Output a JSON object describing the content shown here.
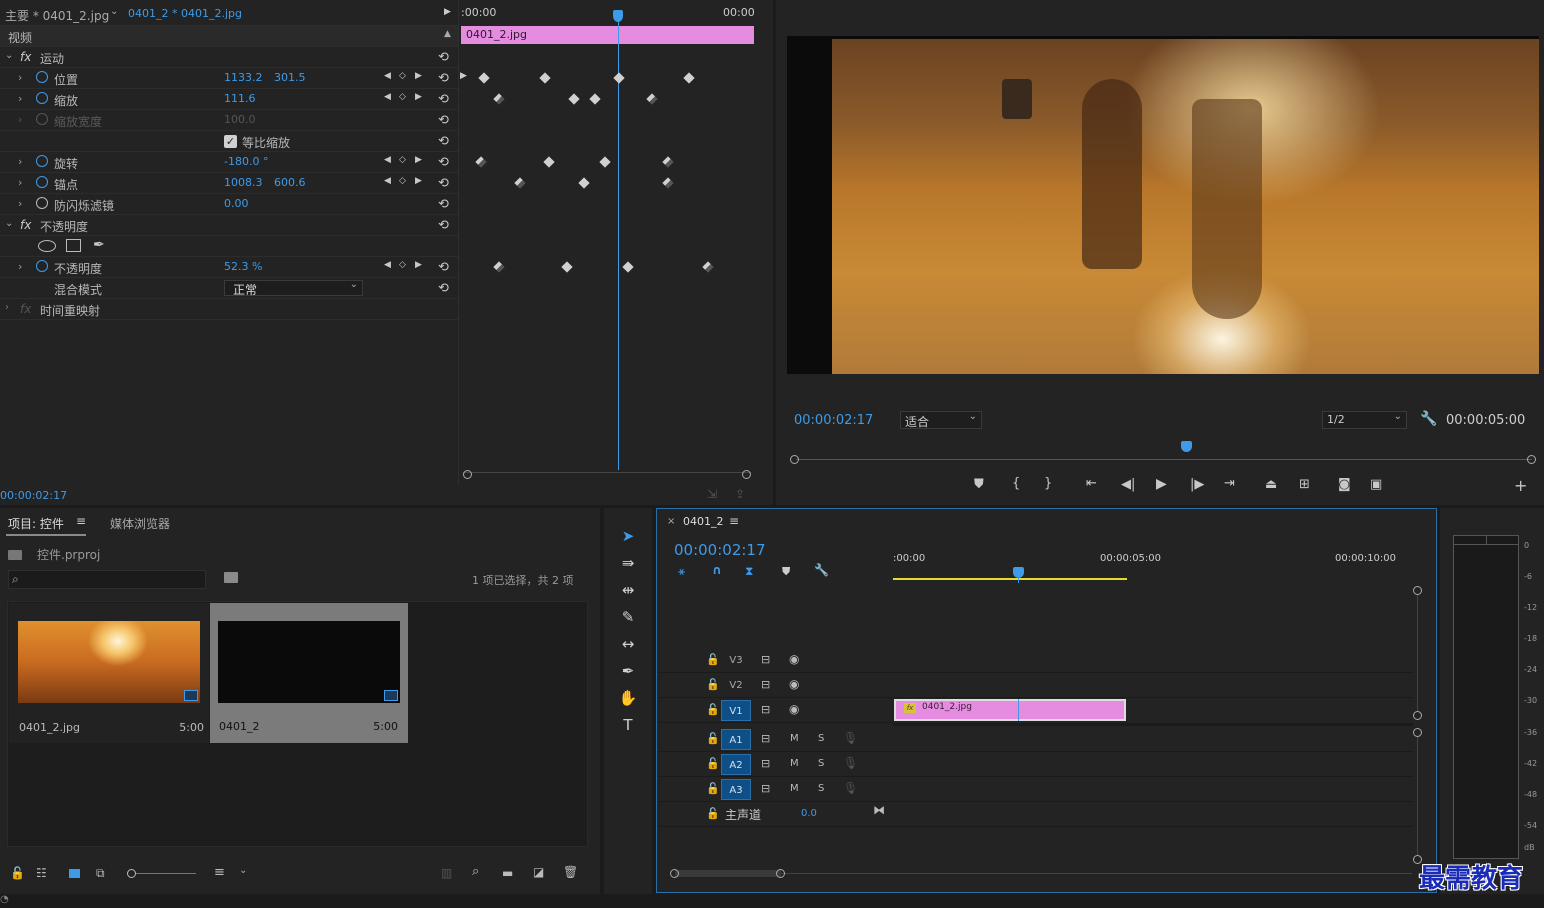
{
  "effect_controls": {
    "tab_main": "主要 * 0401_2.jpg",
    "tab_sequence": "0401_2 * 0401_2.jpg",
    "section_video": "视频",
    "time_start": ":00:00",
    "time_end": "00:00",
    "clip_label": "0401_2.jpg",
    "current_time": "00:00:02:17",
    "motion": {
      "label": "运动",
      "position": {
        "label": "位置",
        "x": "1133.2",
        "y": "301.5"
      },
      "scale": {
        "label": "缩放",
        "value": "111.6"
      },
      "scale_width": {
        "label": "缩放宽度",
        "value": "100.0"
      },
      "uniform_scale": "等比缩放",
      "rotation": {
        "label": "旋转",
        "value": "-180.0 °"
      },
      "anchor": {
        "label": "锚点",
        "x": "1008.3",
        "y": "600.6"
      },
      "anti_flicker": {
        "label": "防闪烁滤镜",
        "value": "0.00"
      }
    },
    "opacity": {
      "label": "不透明度",
      "opacity_param": {
        "label": "不透明度",
        "value": "52.3 %"
      },
      "blend_mode": {
        "label": "混合模式",
        "value": "正常"
      }
    },
    "time_remap": "时间重映射"
  },
  "program_monitor": {
    "timecode": "00:00:02:17",
    "fit": "适合",
    "resolution": "1/2",
    "duration": "00:00:05:00"
  },
  "project": {
    "tab_project": "项目: 控件",
    "tab_media": "媒体浏览器",
    "file": "控件.prproj",
    "selection_info": "1 项已选择，共 2 项",
    "items": [
      {
        "name": "0401_2.jpg",
        "duration": "5:00"
      },
      {
        "name": "0401_2",
        "duration": "5:00"
      }
    ]
  },
  "timeline": {
    "tab": "0401_2",
    "timecode": "00:00:02:17",
    "ruler": [
      ":00:00",
      "00:00:05:00",
      "00:00:10:00"
    ],
    "clip_label": "0401_2.jpg",
    "video_tracks": [
      "V3",
      "V2",
      "V1"
    ],
    "audio_tracks": [
      "A1",
      "A2",
      "A3"
    ],
    "mute": "M",
    "solo": "S",
    "master": {
      "label": "主声道",
      "value": "0.0"
    }
  },
  "meter": {
    "labels": [
      "0",
      "-6",
      "-12",
      "-18",
      "-24",
      "-30",
      "-36",
      "-42",
      "-48",
      "-54",
      "dB"
    ]
  },
  "watermark": "最需教育",
  "colors": {
    "accent": "#3d9be9",
    "clip": "#e68ce0",
    "workarea": "#e8d92e"
  }
}
